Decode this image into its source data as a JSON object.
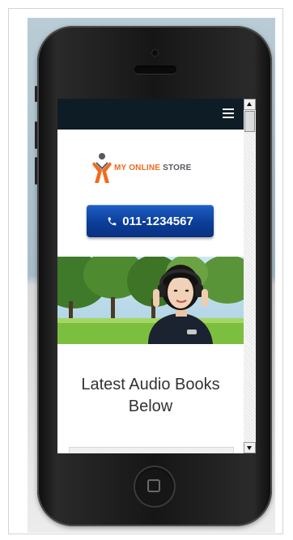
{
  "logo": {
    "part1": "MY ONLINE",
    "part2": "STORE"
  },
  "call_button": {
    "label": "011-1234567"
  },
  "heading": {
    "line1": "Latest Audio Books",
    "line2": "Below"
  },
  "colors": {
    "navbar": "#0e1c26",
    "call_button": "#0b3e9a",
    "logo_accent": "#f26b1d",
    "logo_gray": "#555a60"
  },
  "icons": [
    "hamburger-menu-icon",
    "phone-icon",
    "logo-figure-icon",
    "home-button-icon"
  ]
}
